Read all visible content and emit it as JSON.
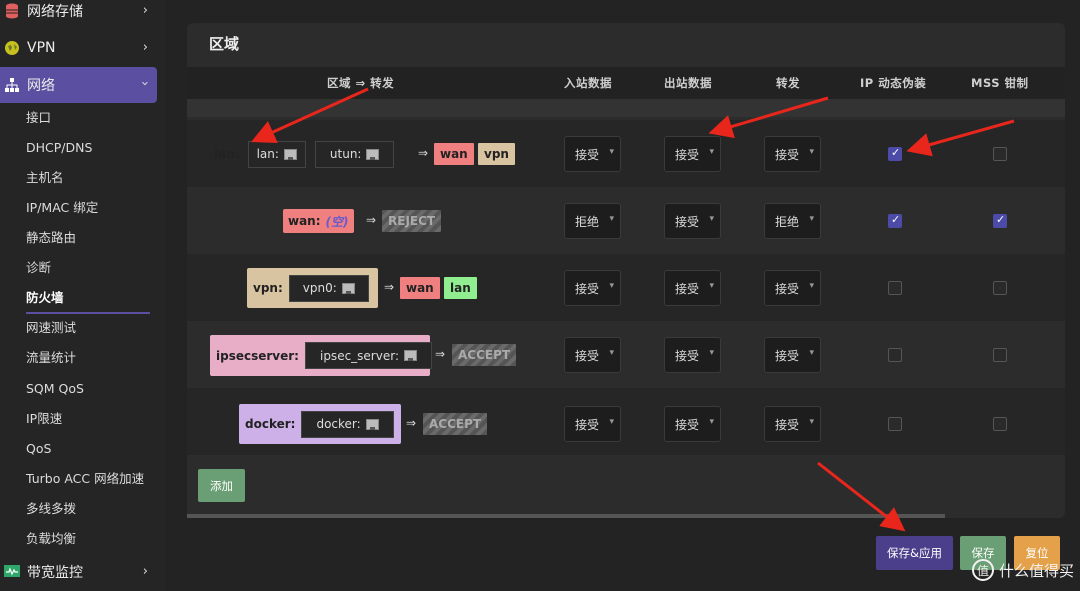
{
  "sidebar": {
    "top_items": [
      {
        "label": "网络存储",
        "icon": "database-icon"
      },
      {
        "label": "VPN",
        "icon": "globe-icon"
      },
      {
        "label": "网络",
        "icon": "network-icon"
      }
    ],
    "sub_items": [
      "接口",
      "DHCP/DNS",
      "主机名",
      "IP/MAC 绑定",
      "静态路由",
      "诊断",
      "防火墙",
      "网速测试",
      "流量统计",
      "SQM QoS",
      "IP限速",
      "QoS",
      "Turbo ACC 网络加速",
      "多线多拨",
      "负载均衡"
    ],
    "selected_sub": "防火墙",
    "bottom_item": {
      "label": "带宽监控",
      "icon": "monitor-icon"
    }
  },
  "panel": {
    "title": "区域",
    "headers": [
      "区域 ⇒ 转发",
      "入站数据",
      "出站数据",
      "转发",
      "IP 动态伪装",
      "MSS 钳制"
    ]
  },
  "zones": [
    {
      "name": "lan:",
      "color": "#90ee90",
      "devices": [
        "lan:",
        "utun:"
      ],
      "targets": [
        {
          "label": "wan",
          "color": "#f08080"
        },
        {
          "label": "vpn",
          "color": "#d8c4a0"
        }
      ],
      "input": "接受",
      "output": "接受",
      "forward": "接受",
      "masq": true,
      "mss": false
    },
    {
      "name": "wan:",
      "color": "#f08080",
      "devices_text": "(空)",
      "targets": [
        {
          "label": "REJECT",
          "hatch": true
        }
      ],
      "input": "拒绝",
      "output": "接受",
      "forward": "拒绝",
      "masq": true,
      "mss": true
    },
    {
      "name": "vpn:",
      "color": "#d8c4a0",
      "devices": [
        "vpn0:"
      ],
      "targets": [
        {
          "label": "wan",
          "color": "#f08080"
        },
        {
          "label": "lan",
          "color": "#90ee90"
        }
      ],
      "input": "接受",
      "output": "接受",
      "forward": "接受",
      "masq": false,
      "mss": false
    },
    {
      "name": "ipsecserver:",
      "color": "#e8aec8",
      "devices": [
        "ipsec_server:"
      ],
      "targets": [
        {
          "label": "ACCEPT",
          "hatch": true
        }
      ],
      "input": "接受",
      "output": "接受",
      "forward": "接受",
      "masq": false,
      "mss": false
    },
    {
      "name": "docker:",
      "color": "#cdb0e8",
      "devices": [
        "docker:"
      ],
      "targets": [
        {
          "label": "ACCEPT",
          "hatch": true
        }
      ],
      "input": "接受",
      "output": "接受",
      "forward": "接受",
      "masq": false,
      "mss": false
    }
  ],
  "buttons": {
    "add": "添加",
    "save_apply": "保存&应用",
    "save": "保存",
    "reset": "复位"
  },
  "watermark": "什么值得买",
  "colors": {
    "accent": "#5a4fa0",
    "annotation_arrow": "#e8261c"
  }
}
